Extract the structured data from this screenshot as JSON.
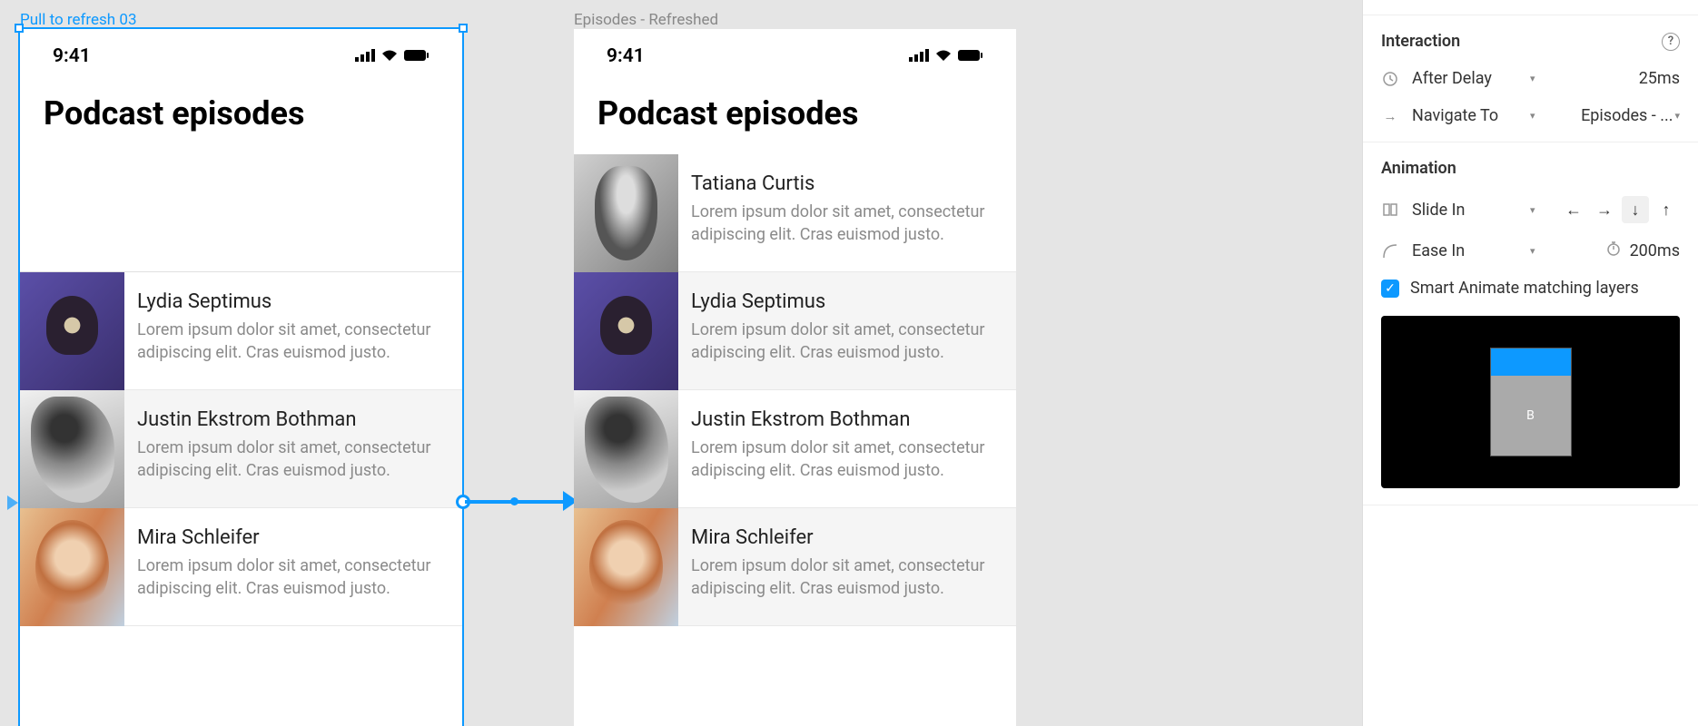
{
  "canvas": {
    "frame_left": {
      "label": "Pull to refresh 03",
      "status_time": "9:41",
      "title": "Podcast episodes",
      "episodes": [
        {
          "name": "Lydia Septimus",
          "desc": "Lorem ipsum dolor sit amet, consectetur adipiscing elit. Cras euismod justo."
        },
        {
          "name": "Justin Ekstrom Bothman",
          "desc": "Lorem ipsum dolor sit amet, consectetur adipiscing elit. Cras euismod justo."
        },
        {
          "name": "Mira Schleifer",
          "desc": "Lorem ipsum dolor sit amet, consectetur adipiscing elit. Cras euismod justo."
        }
      ]
    },
    "frame_right": {
      "label": "Episodes - Refreshed",
      "status_time": "9:41",
      "title": "Podcast episodes",
      "episodes": [
        {
          "name": "Tatiana Curtis",
          "desc": "Lorem ipsum dolor sit amet, consectetur adipiscing elit. Cras euismod justo."
        },
        {
          "name": "Lydia Septimus",
          "desc": "Lorem ipsum dolor sit amet, consectetur adipiscing elit. Cras euismod justo."
        },
        {
          "name": "Justin Ekstrom Bothman",
          "desc": "Lorem ipsum dolor sit amet, consectetur adipiscing elit. Cras euismod justo."
        },
        {
          "name": "Mira Schleifer",
          "desc": "Lorem ipsum dolor sit amet, consectetur adipiscing elit. Cras euismod justo."
        }
      ]
    }
  },
  "panel": {
    "interaction": {
      "header": "Interaction",
      "trigger_label": "After Delay",
      "trigger_value": "25ms",
      "action_label": "Navigate To",
      "action_value": "Episodes - ..."
    },
    "animation": {
      "header": "Animation",
      "type_label": "Slide In",
      "direction_active": "down",
      "easing_label": "Ease In",
      "duration_value": "200ms",
      "smart_animate_label": "Smart Animate matching layers",
      "preview_letter": "B"
    }
  },
  "icons": {
    "signal": "▮▮▮▮",
    "wifi": "◉",
    "battery": "▬"
  }
}
